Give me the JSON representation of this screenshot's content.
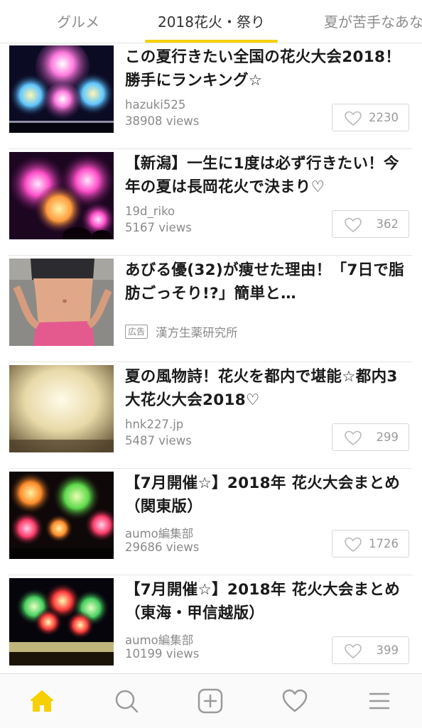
{
  "tabs": [
    {
      "label": "グルメ",
      "active": false
    },
    {
      "label": "2018花火・祭り",
      "active": true
    },
    {
      "label": "夏が苦手なあな",
      "active": false
    }
  ],
  "colors": {
    "accent": "#f6d000",
    "text_secondary": "#8a8a8a"
  },
  "articles": [
    {
      "title": "この夏行きたい全国の花火大会2018！勝手にランキング☆",
      "author": "hazuki525",
      "views": "38908 views",
      "likes": "2230",
      "thumbnail": "fireworks-over-river-image"
    },
    {
      "title": "【新潟】一生に1度は必ず行きたい！今年の夏は長岡花火で決まり♡",
      "author": "19d_riko",
      "views": "5167 views",
      "likes": "362",
      "thumbnail": "pink-fireworks-image"
    },
    {
      "title": "あびる優(32)が痩せた理由！「7日で脂肪ごっそり!?」簡単と…",
      "ad_badge": "広告",
      "sponsor": "漢方生薬研究所",
      "thumbnail": "woman-waist-image"
    },
    {
      "title": "夏の風物詩！花火を都内で堪能☆都内3大花火大会2018♡",
      "author": "hnk227.jp",
      "views": "5487 views",
      "likes": "299",
      "thumbnail": "golden-fireworks-image"
    },
    {
      "title": "【7月開催☆】2018年 花火大会まとめ（関東版）",
      "author": "aumo編集部",
      "views": "29686 views",
      "likes": "1726",
      "thumbnail": "colorful-fireworks-image"
    },
    {
      "title": "【7月開催☆】2018年 花火大会まとめ（東海・甲信越版）",
      "author": "aumo編集部",
      "views": "10199 views",
      "likes": "399",
      "thumbnail": "fireworks-over-water-image"
    }
  ],
  "bottom_nav": [
    {
      "icon": "home-icon",
      "active": true
    },
    {
      "icon": "search-icon",
      "active": false
    },
    {
      "icon": "add-icon",
      "active": false
    },
    {
      "icon": "heart-icon",
      "active": false
    },
    {
      "icon": "menu-icon",
      "active": false
    }
  ]
}
